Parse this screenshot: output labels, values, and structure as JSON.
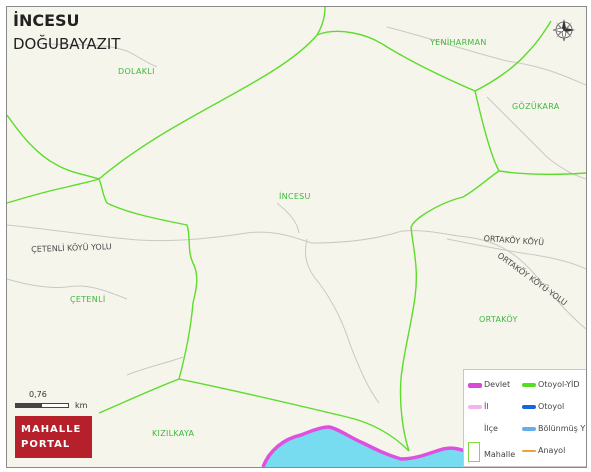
{
  "header": {
    "title": "İNCESU",
    "subtitle": "DOĞUBAYAZIT"
  },
  "villages": {
    "dolakli": "DOLAKLI",
    "yeniharman": "YENİHARMAN",
    "gozukara": "GÖZÜKARA",
    "incesu": "İNCESU",
    "cetenli": "ÇETENLİ",
    "ortakoy": "ORTAKÖY",
    "kizilkaya": "KIZILKAYA"
  },
  "roads": {
    "cetenli_road": "ÇETENLİ KÖYÜ YOLU",
    "ortakoy_road_1": "ORTAKÖY KÖYÜ",
    "ortakoy_road_2": "ORTAKÖY KÖYÜ YOLU"
  },
  "scale": {
    "value": "0,76",
    "unit": "km"
  },
  "logo": {
    "line1": "MAHALLE",
    "line2": "PORTAL"
  },
  "compass": {
    "icon": "compass-rose-icon",
    "north": "N"
  },
  "legend": {
    "items": [
      {
        "label": "Devlet",
        "color": "#d64ad6"
      },
      {
        "label": "Otoyol-YİD",
        "color": "#55dd22"
      },
      {
        "label": "İl",
        "color": "#f3b3ee"
      },
      {
        "label": "Otoyol",
        "color": "#1566e0"
      },
      {
        "label": "İlçe",
        "color": "#ffffff"
      },
      {
        "label": "Bölünmüş Y",
        "color": "#67aee8"
      },
      {
        "label": "Mahalle",
        "color": "#7fdc3a"
      },
      {
        "label": "Anayol",
        "color": "#f2a03c"
      }
    ]
  },
  "colors": {
    "background": "#f6f5ec",
    "boundary": "#5ddc2c",
    "water": "#78dcf0",
    "state_road": "#e050e0",
    "local_road": "#c8c8c8",
    "brand": "#b5202a"
  }
}
